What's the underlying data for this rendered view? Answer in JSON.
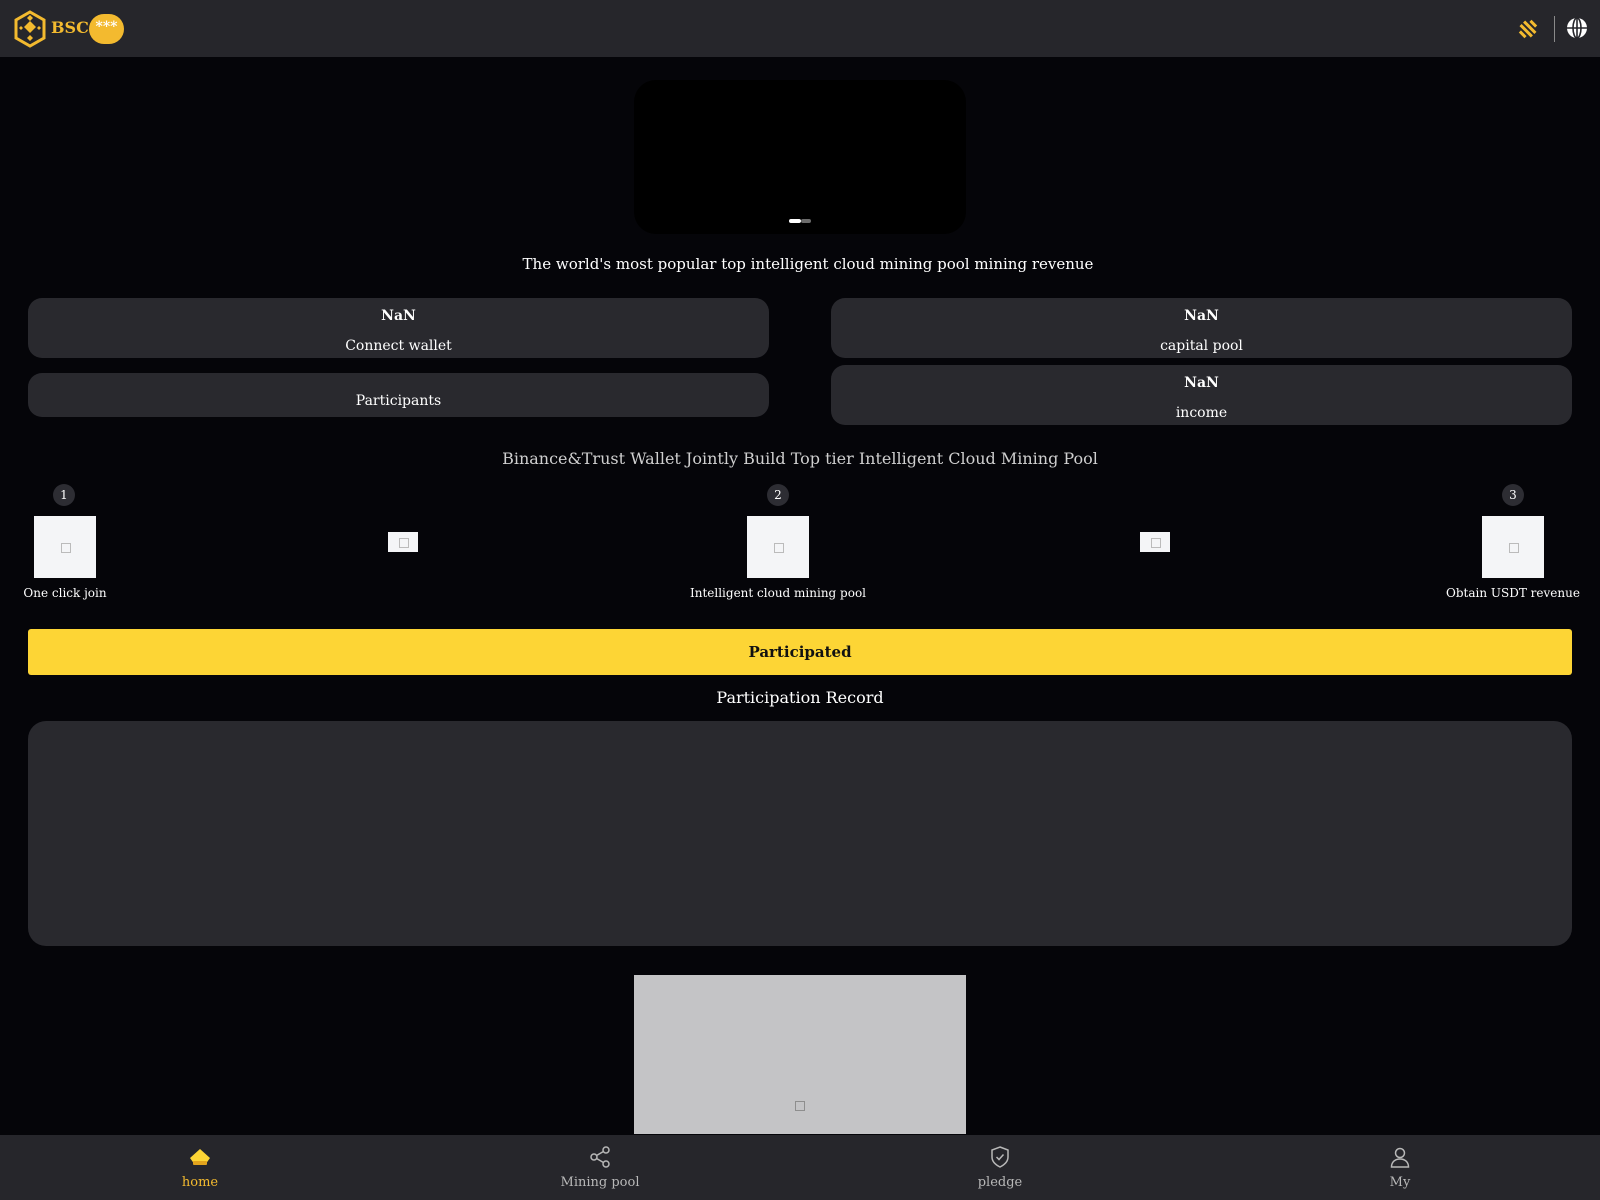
{
  "header": {
    "brand": "BSC",
    "wallet_badge": "***",
    "icons": [
      "bnb-logo-icon",
      "binance-icon",
      "globe-icon"
    ]
  },
  "banner": {
    "active_slide": 1,
    "slide_count": 2
  },
  "tagline": "The world's most popular top intelligent cloud mining pool mining revenue",
  "stats": [
    {
      "value": "NaN",
      "label": "Connect wallet"
    },
    {
      "value": "NaN",
      "label": "capital pool"
    },
    {
      "value": "",
      "label": "Participants"
    },
    {
      "value": "NaN",
      "label": "income"
    }
  ],
  "section_title": "Binance&Trust Wallet Jointly Build Top tier Intelligent Cloud Mining Pool",
  "steps": [
    {
      "number": "1",
      "label": "One click join"
    },
    {
      "number": "2",
      "label": "Intelligent cloud mining pool"
    },
    {
      "number": "3",
      "label": "Obtain USDT revenue"
    }
  ],
  "cta_label": "Participated",
  "record_title": "Participation Record",
  "nav": [
    {
      "label": "home",
      "icon": "home-icon",
      "active": true
    },
    {
      "label": "Mining pool",
      "icon": "share-icon",
      "active": false
    },
    {
      "label": "pledge",
      "icon": "shield-icon",
      "active": false
    },
    {
      "label": "My",
      "icon": "user-icon",
      "active": false
    }
  ],
  "colors": {
    "accent": "#f3ba2f",
    "button": "#fdd535",
    "background": "#050509",
    "surface": "#29292e",
    "header": "#26262b"
  }
}
